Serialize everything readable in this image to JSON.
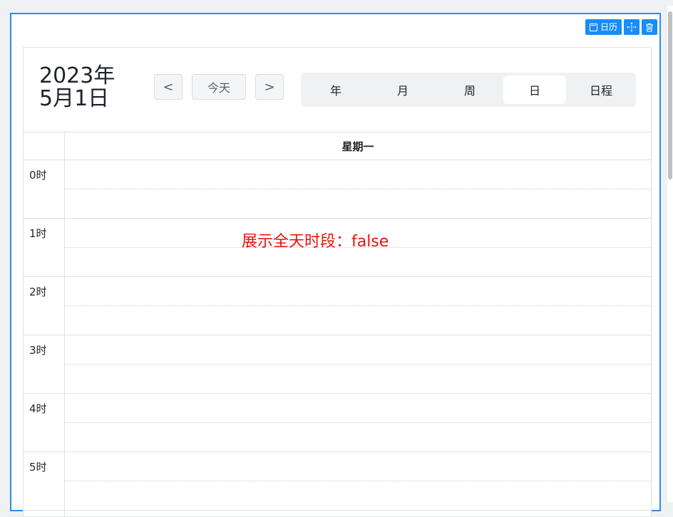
{
  "widget": {
    "toolbar": {
      "name_label": "日历",
      "icons": [
        "calendar-icon",
        "move-icon",
        "delete-icon"
      ]
    }
  },
  "calendar": {
    "title_line1": "2023年",
    "title_line2": "5月1日",
    "nav": {
      "prev": "<",
      "today": "今天",
      "next": ">"
    },
    "views": [
      "年",
      "月",
      "周",
      "日",
      "日程"
    ],
    "active_view": "日",
    "weekday": "星期一",
    "hours": [
      "0时",
      "1时",
      "2时",
      "3时",
      "4时",
      "5时"
    ]
  },
  "annotation": {
    "text": "展示全天时段：false",
    "color": "#e8130b"
  },
  "colors": {
    "accent": "#2b8ef0",
    "toolbar_button": "#1a8cf7"
  }
}
